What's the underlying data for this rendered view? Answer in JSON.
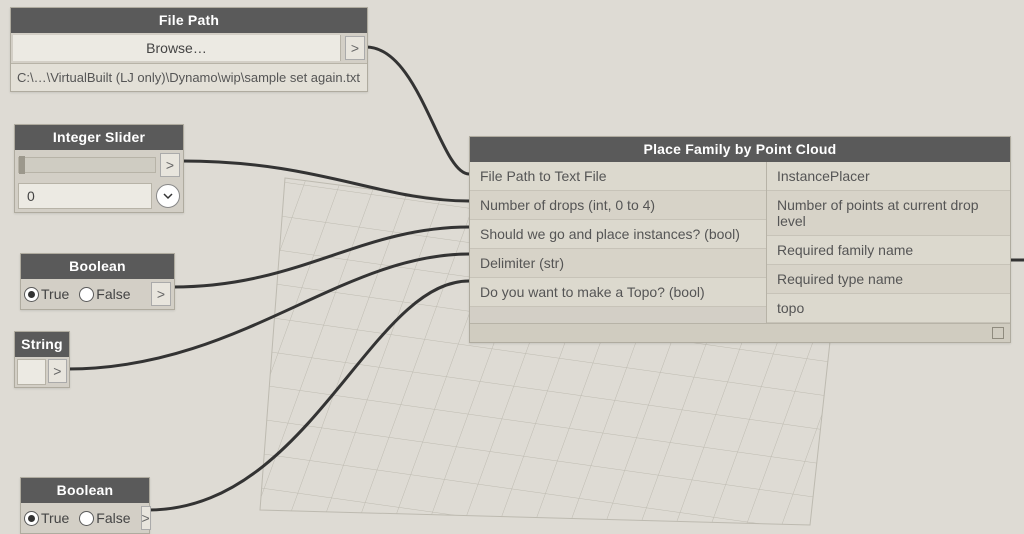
{
  "nodes": {
    "filePath": {
      "title": "File Path",
      "browse": "Browse…",
      "port": ">",
      "path": "C:\\…\\VirtualBuilt (LJ only)\\Dynamo\\wip\\sample set again.txt"
    },
    "intSlider": {
      "title": "Integer Slider",
      "port": ">",
      "value": "0"
    },
    "bool1": {
      "title": "Boolean",
      "trueLabel": "True",
      "falseLabel": "False",
      "port": ">"
    },
    "string": {
      "title": "String",
      "port": ">"
    },
    "bool2": {
      "title": "Boolean",
      "trueLabel": "True",
      "falseLabel": "False",
      "port": ">"
    },
    "custom": {
      "title": "Place Family by Point Cloud",
      "inputs": [
        "File Path to Text File",
        "Number of drops (int, 0 to 4)",
        "Should we go and place instances? (bool)",
        "Delimiter (str)",
        "Do you want to make a Topo? (bool)"
      ],
      "outputs": [
        "InstancePlacer",
        "Number of points at current drop level",
        "Required family name",
        "Required type name",
        "topo"
      ]
    }
  }
}
